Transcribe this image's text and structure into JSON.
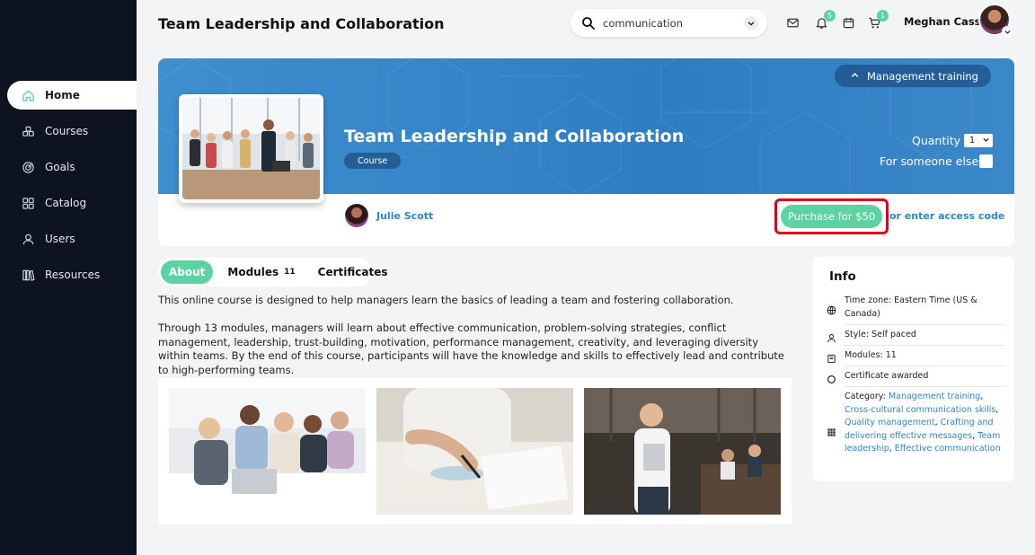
{
  "sidebar": {
    "items": [
      {
        "label": "Home",
        "icon": "home-icon",
        "active": true
      },
      {
        "label": "Courses",
        "icon": "courses-icon"
      },
      {
        "label": "Goals",
        "icon": "goals-icon"
      },
      {
        "label": "Catalog",
        "icon": "catalog-icon"
      },
      {
        "label": "Users",
        "icon": "users-icon"
      },
      {
        "label": "Resources",
        "icon": "resources-icon"
      }
    ]
  },
  "header": {
    "title": "Team Leadership and Collaboration",
    "search_value": "communication",
    "notifications_count": "5",
    "cart_count": "1",
    "user_name": "Meghan Cass"
  },
  "course": {
    "title": "Team Leadership and Collaboration",
    "type": "Course",
    "category_tag": "Management training",
    "quantity_label": "Quantity",
    "quantity_value": "1",
    "someone_else_label": "For someone else",
    "author": "Julie Scott",
    "purchase_label": "Purchase for $50",
    "access_code_label": "or enter access code"
  },
  "tabs": [
    {
      "label": "About",
      "active": true
    },
    {
      "label": "Modules",
      "count": "11"
    },
    {
      "label": "Certificates"
    }
  ],
  "description": [
    "This online course is designed to help managers learn the basics of leading a team and fostering collaboration.",
    "Through 13 modules, managers will learn about effective communication, problem-solving strategies, conflict management, leadership, trust-building, motivation, performance management, creativity, and leveraging diversity within teams. By the end of this course, participants will have the knowledge and skills to effectively lead and contribute to high-performing teams."
  ],
  "info": {
    "title": "Info",
    "timezone": "Time zone: Eastern Time (US & Canada)",
    "style": "Style: Self paced",
    "modules": "Modules: 11",
    "certificate": "Certificate awarded",
    "category_label": "Category:",
    "categories": [
      "Management training",
      "Cross-cultural communication skills",
      "Quality management",
      "Crafting and delivering effective messages",
      "Team leadership",
      "Effective communication"
    ]
  },
  "colors": {
    "accent_green": "#5dd3a3",
    "link_blue": "#2f86c6",
    "sidebar_bg": "#0e1322",
    "banner_blue": "#3a88c9",
    "highlight_red": "#e3001b"
  }
}
